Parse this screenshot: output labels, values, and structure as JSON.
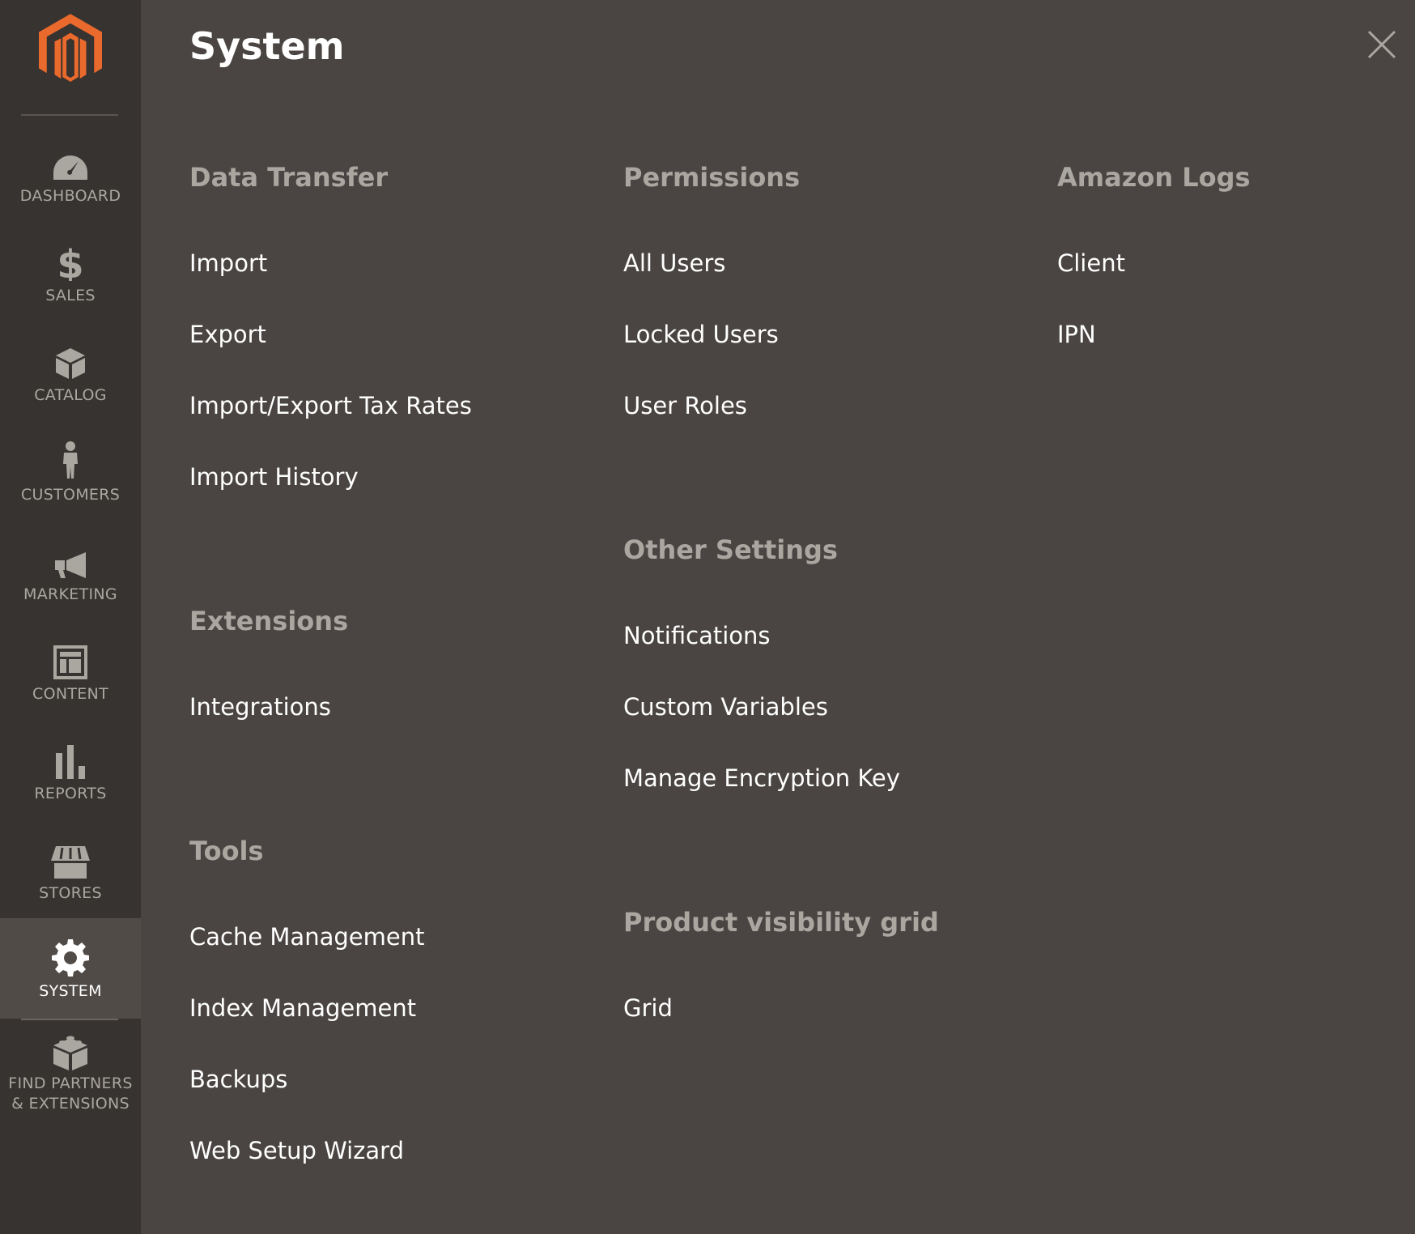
{
  "sidebar": {
    "items": [
      {
        "label": "DASHBOARD",
        "icon": "dashboard-icon"
      },
      {
        "label": "SALES",
        "icon": "dollar-icon"
      },
      {
        "label": "CATALOG",
        "icon": "box-icon"
      },
      {
        "label": "CUSTOMERS",
        "icon": "person-icon"
      },
      {
        "label": "MARKETING",
        "icon": "megaphone-icon"
      },
      {
        "label": "CONTENT",
        "icon": "layout-icon"
      },
      {
        "label": "REPORTS",
        "icon": "bar-chart-icon"
      },
      {
        "label": "STORES",
        "icon": "storefront-icon"
      },
      {
        "label": "SYSTEM",
        "icon": "gear-icon",
        "active": true
      },
      {
        "label_line1": "FIND PARTNERS",
        "label_line2": "& EXTENSIONS",
        "icon": "blocks-icon"
      }
    ]
  },
  "panel": {
    "title": "System",
    "close_icon": "close-icon"
  },
  "sections": {
    "data_transfer": {
      "title": "Data Transfer",
      "links": [
        "Import",
        "Export",
        "Import/Export Tax Rates",
        "Import History"
      ]
    },
    "extensions": {
      "title": "Extensions",
      "links": [
        "Integrations"
      ]
    },
    "tools": {
      "title": "Tools",
      "links": [
        "Cache Management",
        "Index Management",
        "Backups",
        "Web Setup Wizard"
      ]
    },
    "permissions": {
      "title": "Permissions",
      "links": [
        "All Users",
        "Locked Users",
        "User Roles"
      ]
    },
    "other_settings": {
      "title": "Other Settings",
      "links": [
        "Notifications",
        "Custom Variables",
        "Manage Encryption Key"
      ]
    },
    "product_visibility_grid": {
      "title": "Product visibility grid",
      "links": [
        "Grid"
      ]
    },
    "amazon_logs": {
      "title": "Amazon Logs",
      "links": [
        "Client",
        "IPN"
      ]
    }
  },
  "colors": {
    "sidebar_bg": "#373330",
    "panel_bg": "#4a4542",
    "active_bg": "#514b48",
    "logo_orange": "#e96a2c",
    "section_title": "#aaa6a0",
    "link": "#ffffff"
  }
}
